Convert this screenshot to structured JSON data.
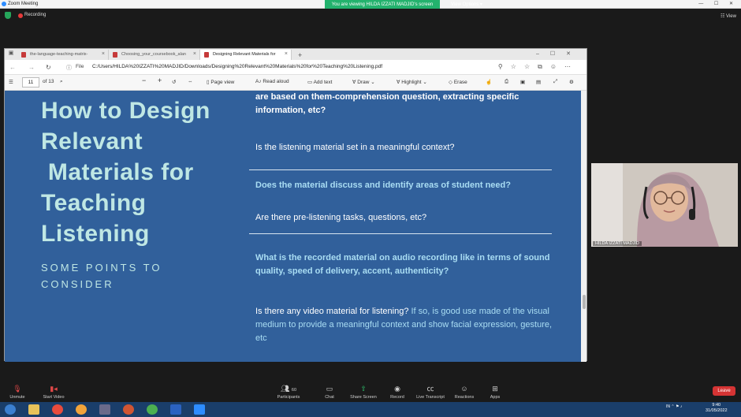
{
  "zoom": {
    "window_title": "Zoom Meeting",
    "recording_label": "Recording",
    "viewing_banner": "You are viewing HILDA IZZATI MADJID's screen",
    "view_options": "View Options ▾",
    "view_button": "☷ View"
  },
  "browser": {
    "tabs": [
      {
        "label": "the-language-teaching-matrix-"
      },
      {
        "label": "Choosing_your_coursebook_alan"
      },
      {
        "label": "Designing Relevant Materials for"
      }
    ],
    "address_prefix": "File",
    "url": "C:/Users/HILDA%20IZZATI%20MADJID/Downloads/Designing%20Relevant%20Materials%20for%20Teaching%20Listening.pdf",
    "pdf_toolbar": {
      "page_current": "11",
      "page_total": "of 13",
      "page_view": "Page view",
      "read_aloud": "Read aloud",
      "add_text": "Add text",
      "draw": "Draw",
      "highlight": "Highlight",
      "erase": "Erase"
    }
  },
  "slide": {
    "title": "How to Design Relevant  Materials for Teaching Listening",
    "title_lines": [
      "How to Design",
      "Relevant",
      " Materials for",
      "Teaching",
      "Listening"
    ],
    "subtitle_lines": [
      "SOME POINTS TO",
      "CONSIDER"
    ],
    "q1": "are based on them-comprehension question, extracting specific information, etc?",
    "q2": "Is the listening material set in a meaningful context?",
    "q3": "Does the material discuss and identify areas of student need?",
    "q4": "Are there pre-listening tasks, questions, etc?",
    "q5": "What is the recorded material on audio recording like in terms of sound quality, speed of delivery, accent, authenticity?",
    "q6_a": "Is there any video material for listening?",
    "q6_b": " If so, is good use made of the visual medium to provide a meaningful context and show facial expression, gesture, etc",
    "accent_color": "#bfe7e4",
    "background_color": "#31609b"
  },
  "participant": {
    "name": "HILDA IZZATI MADJID"
  },
  "controls": {
    "unmute": "Unmute",
    "start_video": "Start Video",
    "participants": "Participants",
    "participants_count": "60",
    "chat": "Chat",
    "share_screen": "Share Screen",
    "record": "Record",
    "live_transcript": "Live Transcript",
    "reactions": "Reactions",
    "apps": "Apps",
    "leave": "Leave"
  },
  "taskbar": {
    "language": "IN",
    "time": "9:40",
    "date": "31/05/2022"
  }
}
